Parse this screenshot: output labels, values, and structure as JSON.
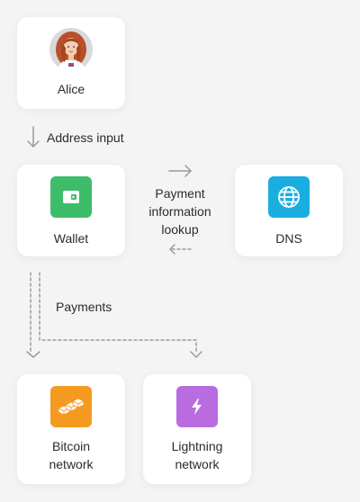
{
  "nodes": {
    "alice": {
      "label": "Alice"
    },
    "wallet": {
      "label": "Wallet"
    },
    "dns": {
      "label": "DNS"
    },
    "bitcoin": {
      "label_line1": "Bitcoin",
      "label_line2": "network"
    },
    "lightning": {
      "label_line1": "Lightning",
      "label_line2": "network"
    }
  },
  "edges": {
    "address_input": "Address input",
    "lookup_line1": "Payment",
    "lookup_line2": "information",
    "lookup_line3": "lookup",
    "payments": "Payments"
  },
  "colors": {
    "background": "#f4f4f5",
    "wallet_tile": "#3dbd6a",
    "dns_tile": "#1aaee0",
    "bitcoin_tile": "#f59a20",
    "lightning_tile": "#b96ce0",
    "arrow": "#9a9aa0"
  },
  "icons": {
    "alice": "avatar",
    "wallet": "wallet-icon",
    "dns": "globe-icon",
    "bitcoin": "blocks-icon",
    "lightning": "lightning-icon"
  }
}
